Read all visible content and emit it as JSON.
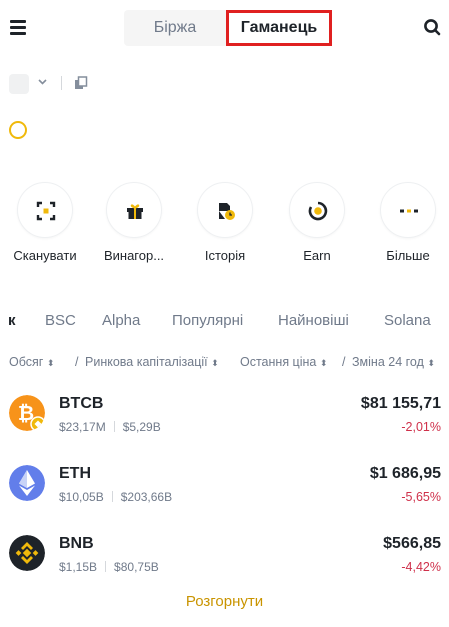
{
  "header": {
    "tabs": [
      {
        "label": "Біржа",
        "active": false
      },
      {
        "label": "Гаманець",
        "active": true
      }
    ]
  },
  "quick_actions": [
    {
      "label": "Сканувати",
      "icon": "scan-icon"
    },
    {
      "label": "Винагор...",
      "icon": "gift-icon"
    },
    {
      "label": "Історія",
      "icon": "history-icon"
    },
    {
      "label": "Earn",
      "icon": "earn-icon"
    },
    {
      "label": "Більше",
      "icon": "more-icon"
    }
  ],
  "categories": [
    "к",
    "BSC",
    "Alpha",
    "Популярні",
    "Найновіші",
    "Solana"
  ],
  "active_category": "к",
  "sort_header": {
    "volume": "Обсяг",
    "sep": "/",
    "market_cap": "Ринкова капіталізації",
    "last_price": "Остання ціна",
    "change": "Зміна 24 год"
  },
  "assets": [
    {
      "symbol": "BTCB",
      "volume": "$23,17M",
      "market_cap": "$5,29B",
      "price": "$81 155,71",
      "change": "-2,01%",
      "color": "#f7931a"
    },
    {
      "symbol": "ETH",
      "volume": "$10,05B",
      "market_cap": "$203,66B",
      "price": "$1 686,95",
      "change": "-5,65%",
      "color": "#627eea"
    },
    {
      "symbol": "BNB",
      "volume": "$1,15B",
      "market_cap": "$80,75B",
      "price": "$566,85",
      "change": "-4,42%",
      "color": "#f0b90b"
    }
  ],
  "expand_label": "Розгорнути",
  "colors": {
    "accent": "#f0b90b",
    "negative": "#cf304a",
    "highlight_border": "#e02020"
  }
}
